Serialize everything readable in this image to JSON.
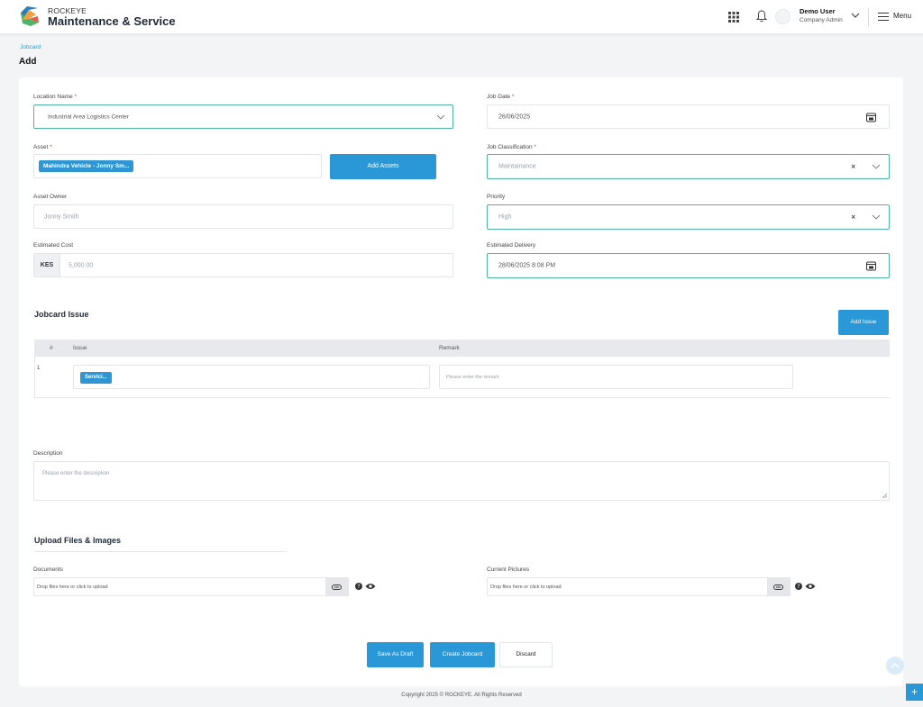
{
  "header": {
    "brand_top": "ROCKEYE",
    "brand_title": "Maintenance & Service",
    "user_name": "Demo User",
    "user_role": "Company Admin",
    "menu_label": "Menu"
  },
  "breadcrumb": "Jobcard",
  "page_title": "Add",
  "form": {
    "location": {
      "label": "Location Name",
      "value": "Industrial Area Logistics Center"
    },
    "job_date": {
      "label": "Job Date",
      "value": "26/06/2025"
    },
    "asset": {
      "label": "Asset",
      "chip": "Mahindra Vehicle - Jonny Sm...",
      "add_button": "Add Assets"
    },
    "job_classification": {
      "label": "Job Classification",
      "value": "Maintainance"
    },
    "asset_owner": {
      "label": "Asset Owner",
      "value": "Jonny Smith"
    },
    "priority": {
      "label": "Priority",
      "value": "High"
    },
    "estimated_cost": {
      "label": "Estimated Cost",
      "currency": "KES",
      "value": "5,000.00"
    },
    "estimated_delivery": {
      "label": "Estimated Delivery",
      "value": "28/06/2025 8:08 PM"
    },
    "required_mark": "*",
    "clear_mark": "×"
  },
  "issues": {
    "title": "Jobcard Issue",
    "add_button": "Add Issue",
    "columns": {
      "num": "#",
      "issue": "Issue",
      "remark": "Remark"
    },
    "rows": [
      {
        "num": "1",
        "chip": "Servici...",
        "remark_placeholder": "Please enter the remark"
      }
    ]
  },
  "description": {
    "label": "Description",
    "placeholder": "Please enter the description"
  },
  "uploads": {
    "title": "Upload Files & Images",
    "documents": {
      "label": "Documents",
      "placeholder": "Drop files here or click to upload"
    },
    "pictures": {
      "label": "Current Pictures",
      "placeholder": "Drop files here or click to upload"
    }
  },
  "actions": {
    "save_draft": "Save As Draft",
    "create": "Create Jobcard",
    "discard": "Discard"
  },
  "footer": "Copyright 2025 © ROCKEYE. All Rights Reserved",
  "fab": "+",
  "colors": {
    "primary": "#2a97d6",
    "focus_border": "#4fb3a6",
    "required": "#e23b3b"
  }
}
